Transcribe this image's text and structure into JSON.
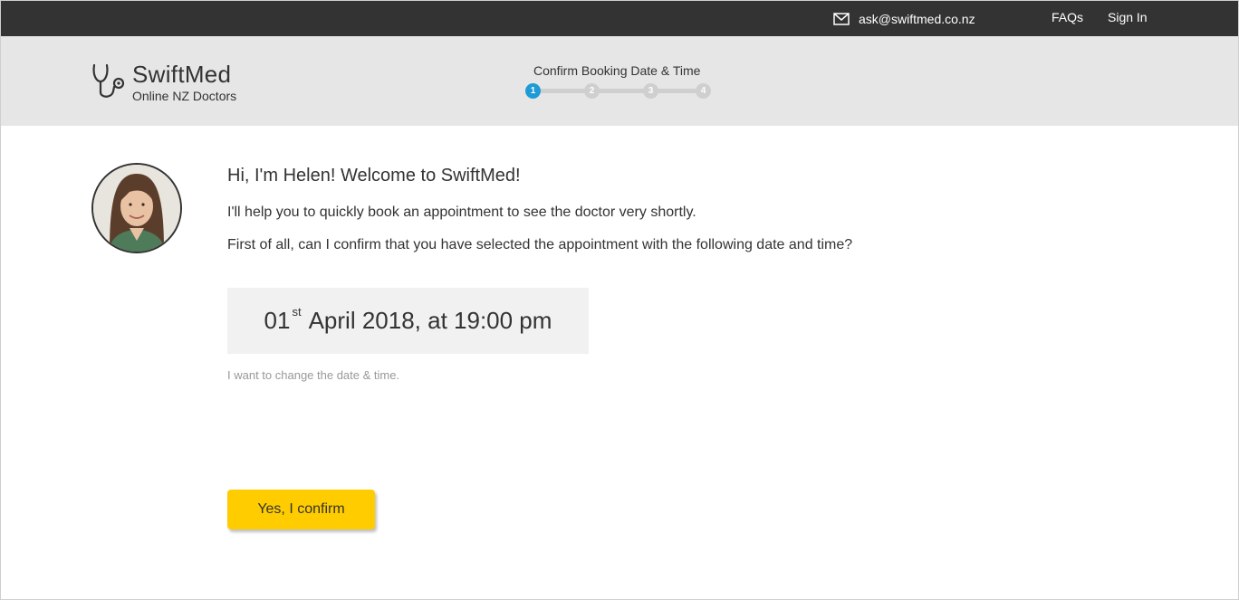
{
  "topbar": {
    "email": "ask@swiftmed.co.nz",
    "email_icon": "envelope-icon",
    "faqs_label": "FAQs",
    "signin_label": "Sign In"
  },
  "header": {
    "brand_name": "SwiftMed",
    "brand_tagline": "Online NZ Doctors",
    "logo_icon": "stethoscope-icon",
    "progress_title": "Confirm Booking Date & Time",
    "steps": [
      "1",
      "2",
      "3",
      "4"
    ],
    "active_step": 1,
    "accent_color": "#1e9bd7"
  },
  "main": {
    "avatar_icon": "helen-avatar",
    "greeting": "Hi, I'm Helen! Welcome to SwiftMed!",
    "line1": "I'll help you to quickly book an appointment to see the doctor very shortly.",
    "line2": "First of all, can I confirm that you have selected the appointment with the following date and time?",
    "date_day": "01",
    "date_suffix": "st",
    "date_rest": "April 2018, at 19:00 pm",
    "change_link": "I want to change the date & time.",
    "confirm_label": "Yes, I confirm",
    "confirm_color": "#ffcc00"
  }
}
